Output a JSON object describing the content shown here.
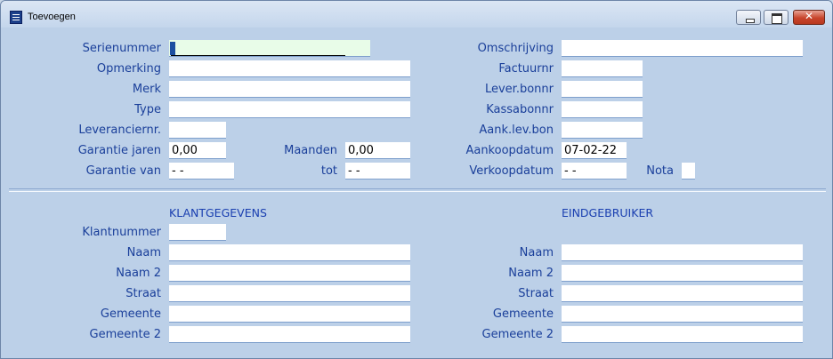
{
  "window": {
    "title": "Toevoegen",
    "close_glyph": "✕"
  },
  "form": {
    "serienummer": {
      "label": "Serienummer",
      "value": ""
    },
    "opmerking": {
      "label": "Opmerking",
      "value": ""
    },
    "merk": {
      "label": "Merk",
      "value": ""
    },
    "type": {
      "label": "Type",
      "value": ""
    },
    "leveranciernr": {
      "label": "Leveranciernr.",
      "value": ""
    },
    "garantie_jaren": {
      "label": "Garantie jaren",
      "value": "0,00"
    },
    "maanden": {
      "label": "Maanden",
      "value": "0,00"
    },
    "garantie_van": {
      "label": "Garantie van",
      "value": "-  -"
    },
    "tot": {
      "label": "tot",
      "value": "-  -"
    },
    "omschrijving": {
      "label": "Omschrijving",
      "value": ""
    },
    "factuurnr": {
      "label": "Factuurnr",
      "value": ""
    },
    "lever_bonnr": {
      "label": "Lever.bonnr",
      "value": ""
    },
    "kassabonnr": {
      "label": "Kassabonnr",
      "value": ""
    },
    "aank_lev_bon": {
      "label": "Aank.lev.bon",
      "value": ""
    },
    "aankoopdatum": {
      "label": "Aankoopdatum",
      "value": "07-02-22"
    },
    "verkoopdatum": {
      "label": "Verkoopdatum",
      "value": "-  -"
    },
    "nota": {
      "label": "Nota",
      "value": ""
    }
  },
  "klant": {
    "heading": "KLANTGEGEVENS",
    "klantnummer": {
      "label": "Klantnummer",
      "value": ""
    },
    "naam": {
      "label": "Naam",
      "value": ""
    },
    "naam2": {
      "label": "Naam 2",
      "value": ""
    },
    "straat": {
      "label": "Straat",
      "value": ""
    },
    "gemeente": {
      "label": "Gemeente",
      "value": ""
    },
    "gemeente2": {
      "label": "Gemeente 2",
      "value": ""
    }
  },
  "eind": {
    "heading": "EINDGEBRUIKER",
    "naam": {
      "label": "Naam",
      "value": ""
    },
    "naam2": {
      "label": "Naam 2",
      "value": ""
    },
    "straat": {
      "label": "Straat",
      "value": ""
    },
    "gemeente": {
      "label": "Gemeente",
      "value": ""
    },
    "gemeente2": {
      "label": "Gemeente 2",
      "value": ""
    }
  }
}
